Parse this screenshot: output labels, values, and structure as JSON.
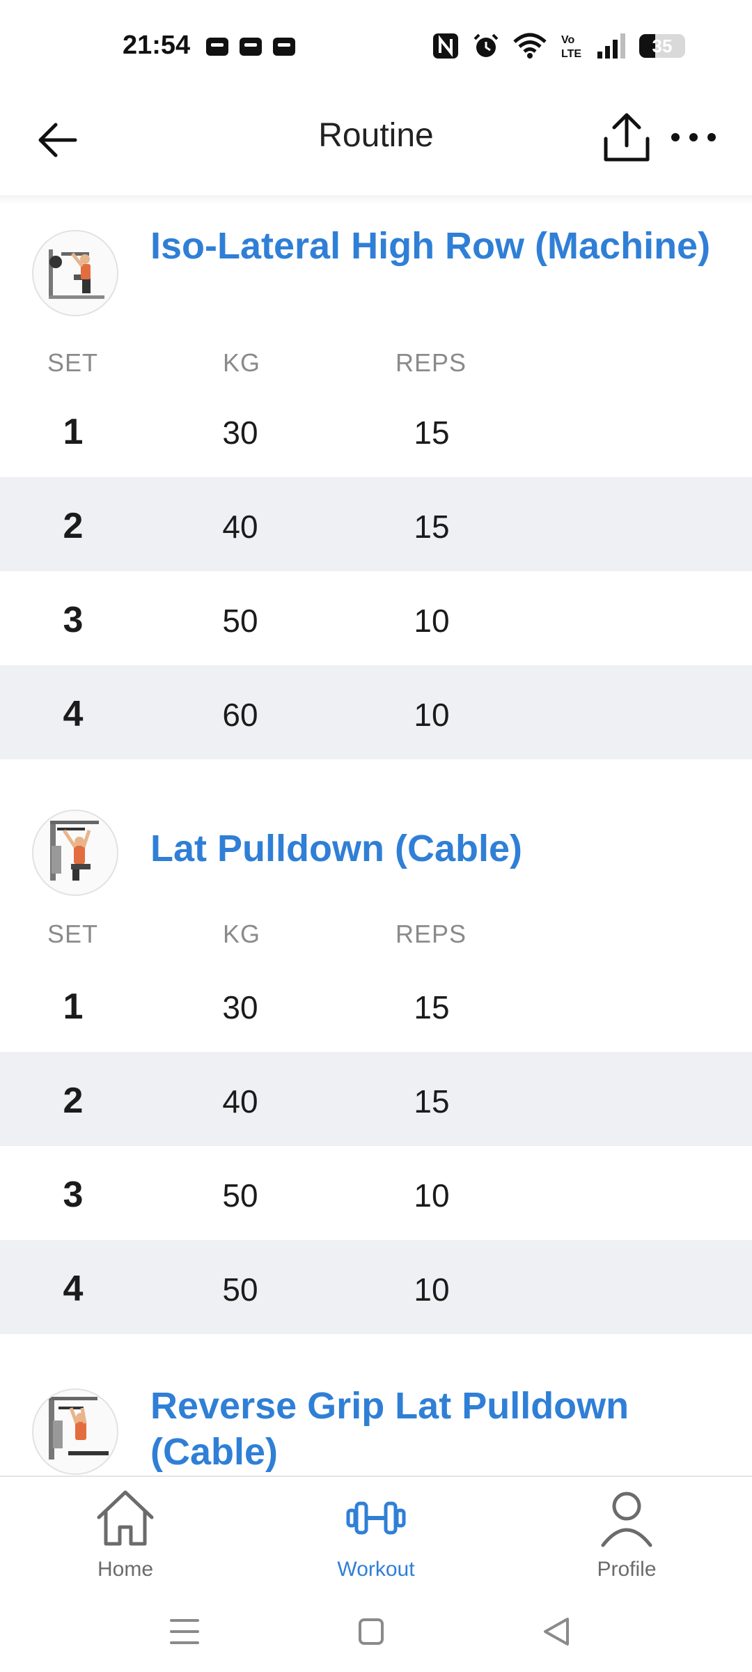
{
  "status_bar": {
    "time": "21:54",
    "notification_icons": [
      "wallet-icon",
      "wallet-icon",
      "wallet-icon"
    ],
    "system_icons": [
      "nfc-icon",
      "alarm-icon",
      "wifi-icon",
      "volte-icon",
      "signal-icon"
    ],
    "volte_label": "Vo\nLTE",
    "battery_level": "35"
  },
  "app_bar": {
    "title": "Routine",
    "back_icon": "arrow-left-icon",
    "share_icon": "share-upload-icon",
    "more_icon": "more-horizontal-icon"
  },
  "columns": {
    "set": "SET",
    "kg": "KG",
    "reps": "REPS"
  },
  "exercises": [
    {
      "title": "Iso-Lateral High Row (Machine)",
      "sets": [
        {
          "set": "1",
          "kg": "30",
          "reps": "15"
        },
        {
          "set": "2",
          "kg": "40",
          "reps": "15"
        },
        {
          "set": "3",
          "kg": "50",
          "reps": "10"
        },
        {
          "set": "4",
          "kg": "60",
          "reps": "10"
        }
      ]
    },
    {
      "title": "Lat Pulldown (Cable)",
      "sets": [
        {
          "set": "1",
          "kg": "30",
          "reps": "15"
        },
        {
          "set": "2",
          "kg": "40",
          "reps": "15"
        },
        {
          "set": "3",
          "kg": "50",
          "reps": "10"
        },
        {
          "set": "4",
          "kg": "50",
          "reps": "10"
        }
      ]
    },
    {
      "title": "Reverse Grip Lat Pulldown (Cable)",
      "sets": []
    }
  ],
  "bottom_nav": {
    "items": [
      {
        "label": "Home",
        "icon": "home-icon",
        "active": false
      },
      {
        "label": "Workout",
        "icon": "dumbbell-icon",
        "active": true
      },
      {
        "label": "Profile",
        "icon": "person-icon",
        "active": false
      }
    ]
  },
  "colors": {
    "accent": "#2f7fd6",
    "row_alt": "#eff0f3",
    "muted_text": "#8a8a8a"
  }
}
